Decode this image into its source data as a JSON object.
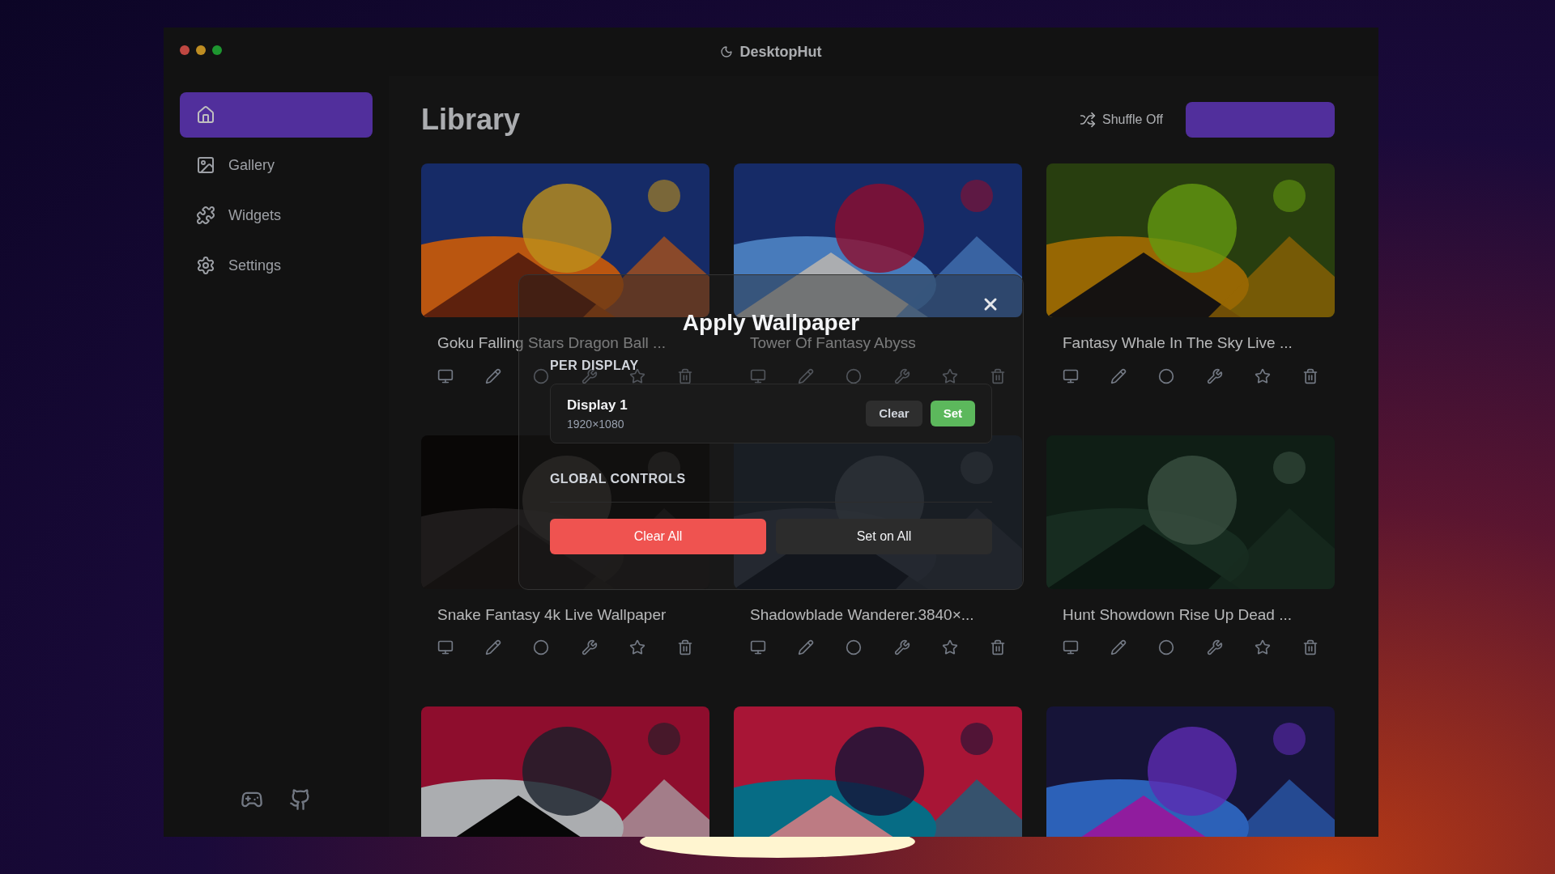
{
  "window": {
    "title": "DesktopHut"
  },
  "sidebar": {
    "items": [
      {
        "kind": "home",
        "selected": true
      },
      {
        "kind": "gallery",
        "label": "Gallery",
        "selected": false
      },
      {
        "kind": "widgets",
        "label": "Widgets",
        "selected": false
      },
      {
        "kind": "settings",
        "label": "Settings",
        "selected": false
      }
    ]
  },
  "header": {
    "title": "Library",
    "shuffle": "Shuffle Off"
  },
  "cards": [
    {
      "kind": "picture",
      "title": "Goku Falling Stars Dragon Ball ..."
    },
    {
      "kind": "picture",
      "title": "Tower Of Fantasy Abyss"
    },
    {
      "kind": "picture",
      "title": "Fantasy Whale In The Sky Live ..."
    },
    {
      "kind": "picture",
      "title": "Snake Fantasy 4k Live Wallpaper"
    },
    {
      "kind": "picture",
      "title": "Shadowblade Wanderer.3840×..."
    },
    {
      "kind": "picture",
      "title": "Hunt Showdown Rise Up Dead ..."
    },
    {
      "kind": "picture"
    },
    {
      "kind": "picture"
    },
    {
      "kind": "picture"
    }
  ],
  "dialog": {
    "title": "Apply Wallpaper",
    "per_display_heading": "PER DISPLAY",
    "displays": [
      {
        "name": "Display 1",
        "resolution": "1920×1080",
        "clear": "Clear",
        "set": "Set"
      }
    ],
    "global_heading": "GLOBAL CONTROLS",
    "clear_all": "Clear All",
    "set_on_all": "Set on All"
  }
}
